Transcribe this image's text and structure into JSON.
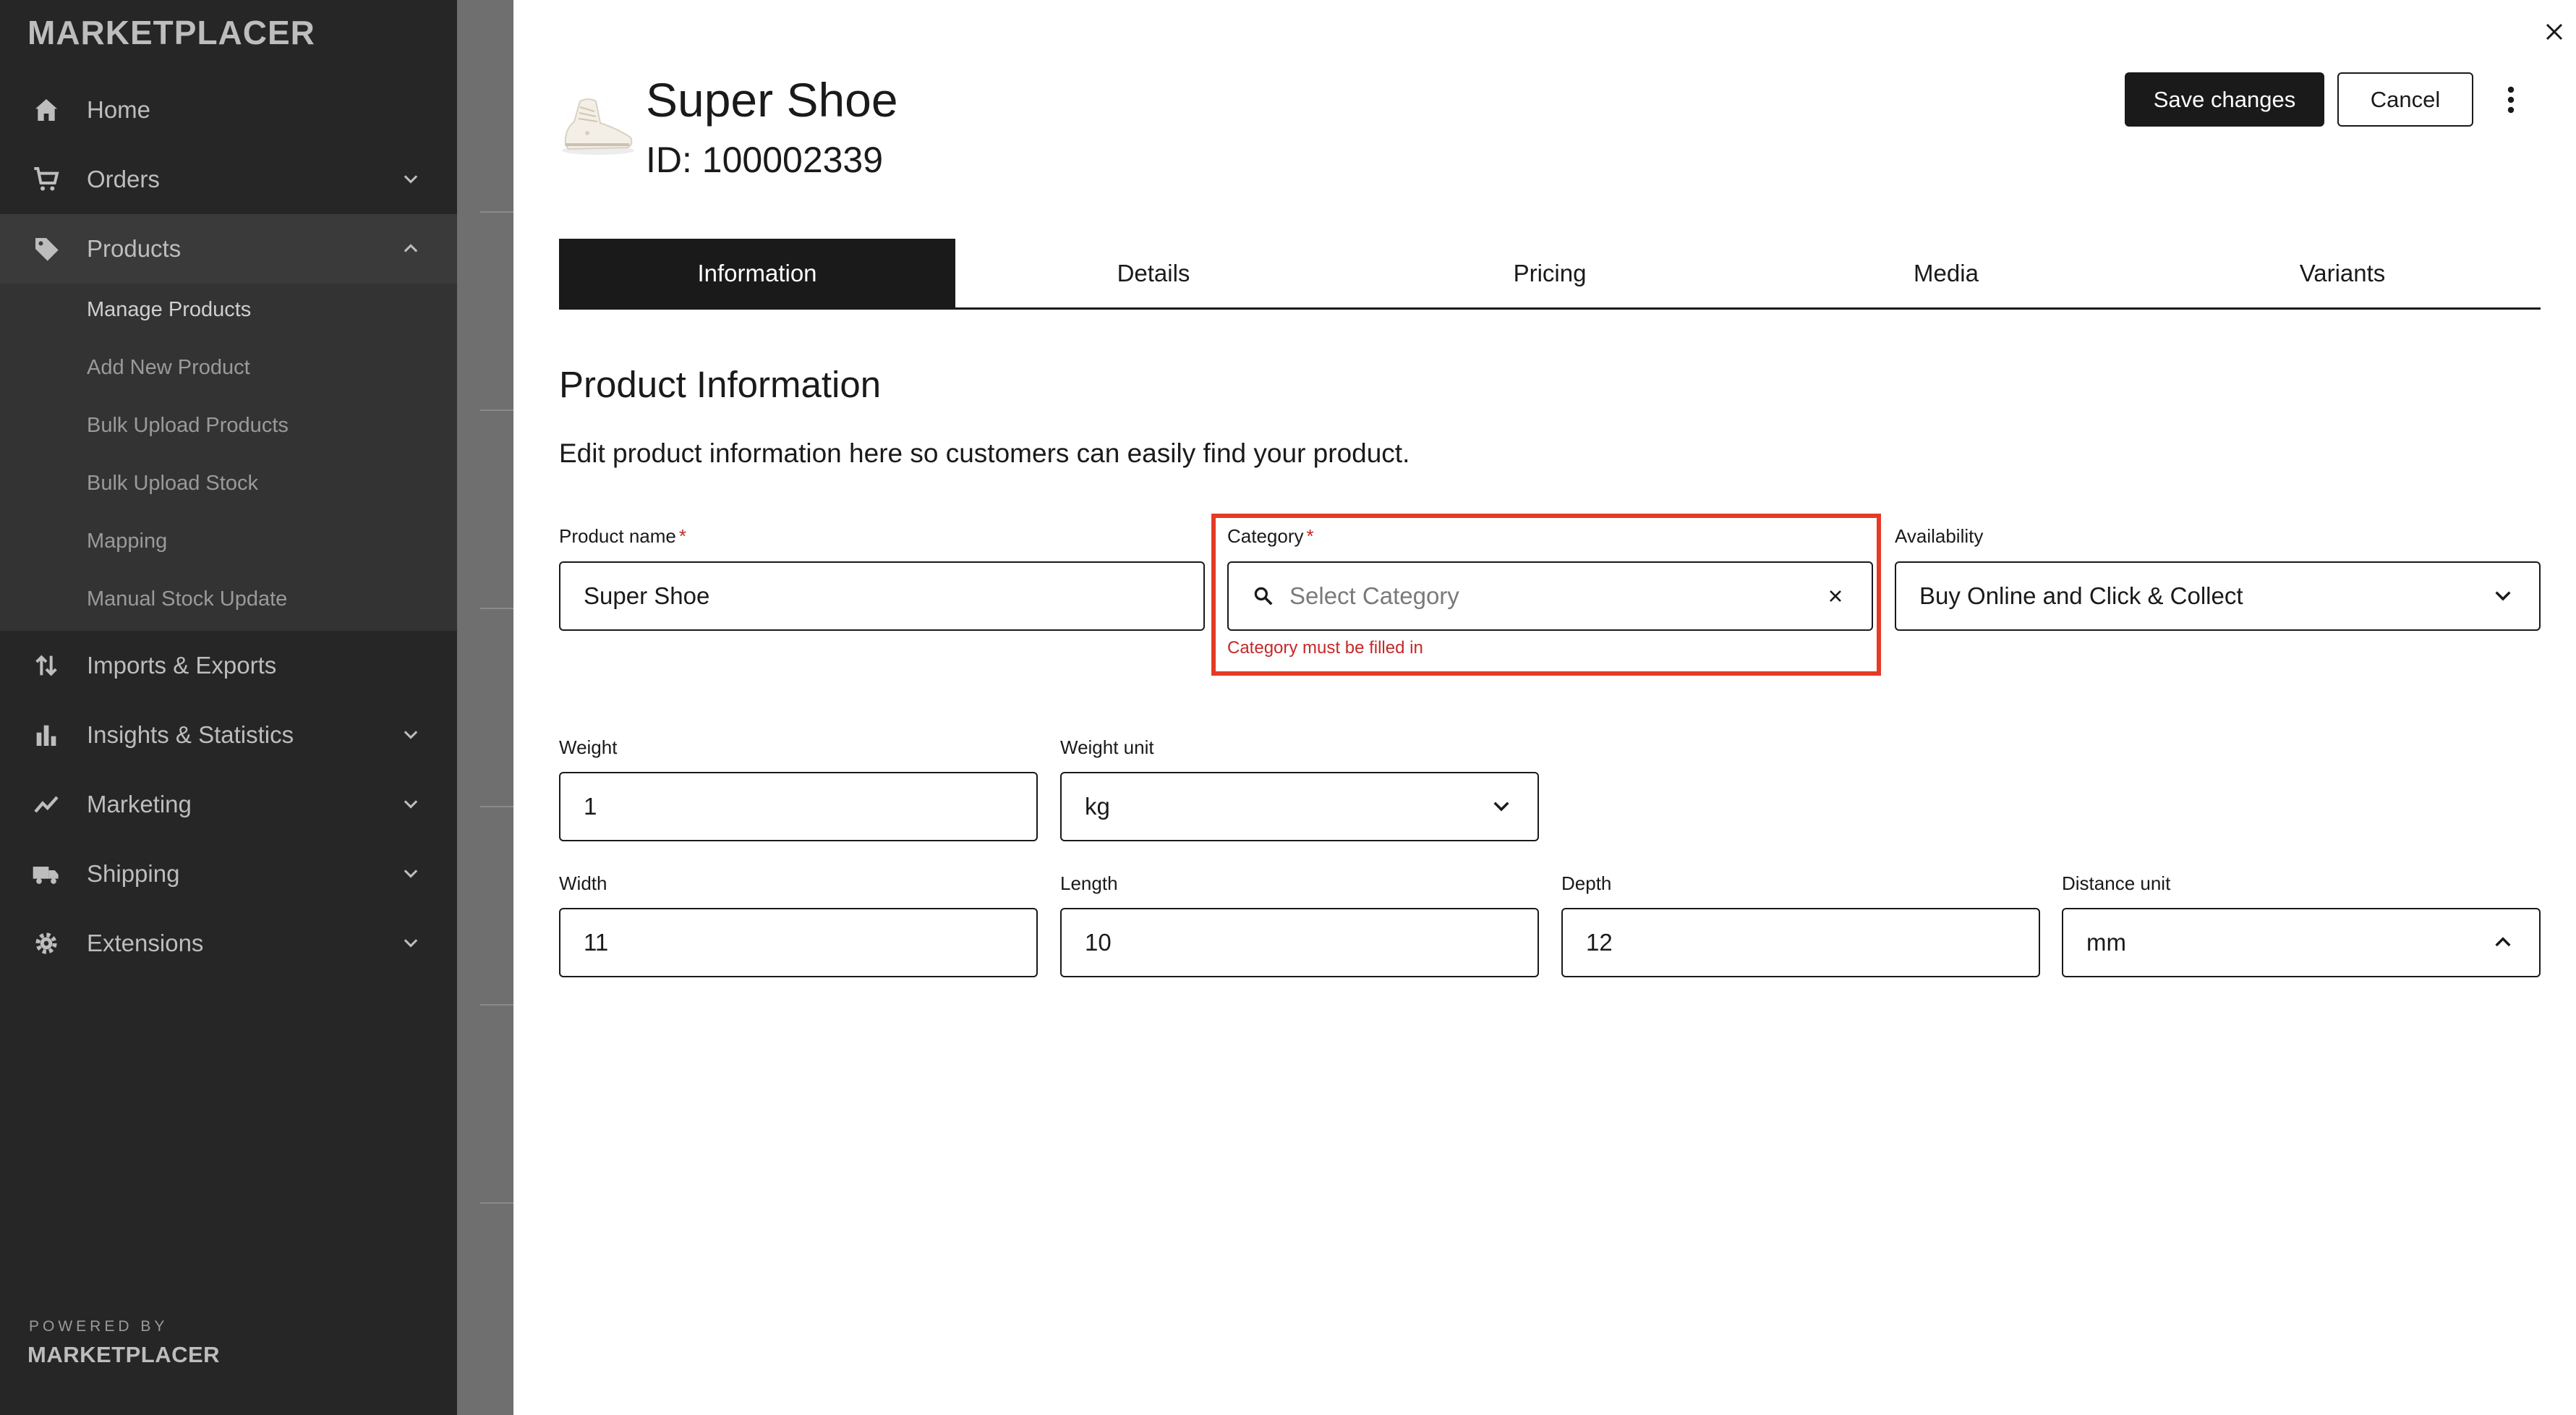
{
  "sidebar": {
    "brand": "MARKETPLACER",
    "items": [
      {
        "label": "Home"
      },
      {
        "label": "Orders"
      },
      {
        "label": "Products"
      },
      {
        "label": "Imports & Exports"
      },
      {
        "label": "Insights & Statistics"
      },
      {
        "label": "Marketing"
      },
      {
        "label": "Shipping"
      },
      {
        "label": "Extensions"
      }
    ],
    "sub_items": [
      {
        "label": "Manage Products"
      },
      {
        "label": "Add New Product"
      },
      {
        "label": "Bulk Upload Products"
      },
      {
        "label": "Bulk Upload Stock"
      },
      {
        "label": "Mapping"
      },
      {
        "label": "Manual Stock Update"
      }
    ],
    "powered_by": "POWERED BY",
    "footer_brand": "MARKETPLACER"
  },
  "header": {
    "title": "Super Shoe",
    "id_text": "ID: 100002339",
    "save_label": "Save changes",
    "cancel_label": "Cancel"
  },
  "tabs": [
    {
      "label": "Information"
    },
    {
      "label": "Details"
    },
    {
      "label": "Pricing"
    },
    {
      "label": "Media"
    },
    {
      "label": "Variants"
    }
  ],
  "section": {
    "title": "Product Information",
    "description": "Edit product information here so customers can easily find your product."
  },
  "form": {
    "product_name": {
      "label": "Product name",
      "required": "*",
      "value": "Super Shoe"
    },
    "category": {
      "label": "Category",
      "required": "*",
      "placeholder": "Select Category",
      "error": "Category must be filled in"
    },
    "availability": {
      "label": "Availability",
      "value": "Buy Online and Click & Collect"
    },
    "weight": {
      "label": "Weight",
      "value": "1"
    },
    "weight_unit": {
      "label": "Weight unit",
      "value": "kg"
    },
    "width": {
      "label": "Width",
      "value": "11"
    },
    "length": {
      "label": "Length",
      "value": "10"
    },
    "depth": {
      "label": "Depth",
      "value": "12"
    },
    "distance_unit": {
      "label": "Distance unit",
      "value": "mm"
    }
  },
  "colors": {
    "sidebar_bg": "#262626",
    "accent_dark": "#1a1a1a",
    "error": "#c62828",
    "highlight": "#e53a26"
  }
}
